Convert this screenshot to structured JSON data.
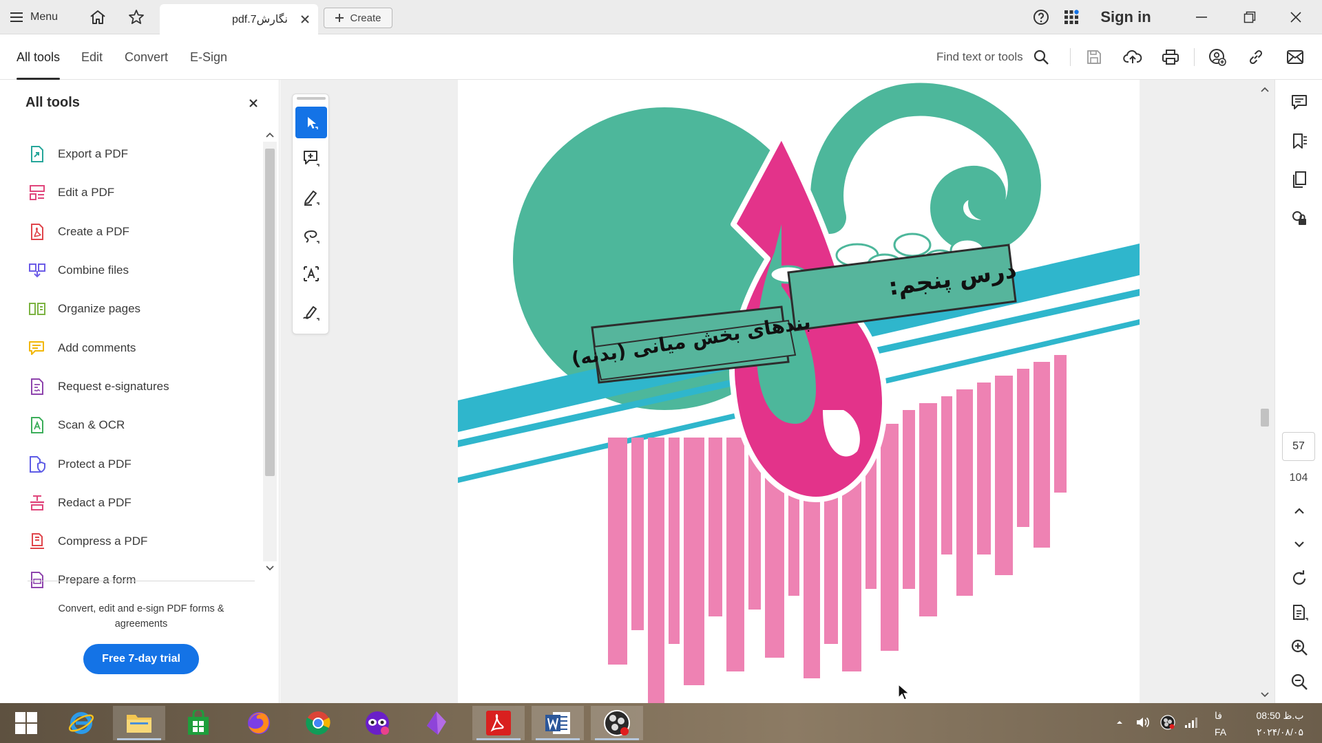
{
  "titlebar": {
    "menu_label": "Menu",
    "doc_tab_title": "نگارش7.pdf",
    "create_label": "Create",
    "sign_in_label": "Sign in"
  },
  "toolbar": {
    "tabs": [
      {
        "label": "All tools"
      },
      {
        "label": "Edit"
      },
      {
        "label": "Convert"
      },
      {
        "label": "E-Sign"
      }
    ],
    "find_placeholder": "Find text or tools"
  },
  "left_panel": {
    "title": "All tools",
    "items": [
      {
        "label": "Export a PDF",
        "icon": "export-pdf-icon",
        "color": "#26a69a"
      },
      {
        "label": "Edit a PDF",
        "icon": "edit-pdf-icon",
        "color": "#e0457b"
      },
      {
        "label": "Create a PDF",
        "icon": "create-pdf-icon",
        "color": "#e0454b"
      },
      {
        "label": "Combine files",
        "icon": "combine-files-icon",
        "color": "#6c5ce7"
      },
      {
        "label": "Organize pages",
        "icon": "organize-pages-icon",
        "color": "#7cb342"
      },
      {
        "label": "Add comments",
        "icon": "add-comments-icon",
        "color": "#f2b705"
      },
      {
        "label": "Request e-signatures",
        "icon": "request-esign-icon",
        "color": "#8e44ad"
      },
      {
        "label": "Scan & OCR",
        "icon": "scan-ocr-icon",
        "color": "#3cae5a"
      },
      {
        "label": "Protect a PDF",
        "icon": "protect-pdf-icon",
        "color": "#5e5ce6"
      },
      {
        "label": "Redact a PDF",
        "icon": "redact-pdf-icon",
        "color": "#e0457b"
      },
      {
        "label": "Compress a PDF",
        "icon": "compress-pdf-icon",
        "color": "#e0454b"
      },
      {
        "label": "Prepare a form",
        "icon": "prepare-form-icon",
        "color": "#8e44ad"
      }
    ],
    "promo_text": "Convert, edit and e-sign PDF forms & agreements",
    "trial_button": "Free 7-day trial"
  },
  "document": {
    "page_title_main": "درس پنجم:",
    "page_title_sub": "بندهای بخش میانی (بدنه)",
    "colors": {
      "teal": "#4db79b",
      "pink": "#e3338a",
      "light_pink": "#ee82b3",
      "cyan": "#2fb6cc",
      "banner": "#56b59c"
    }
  },
  "right_rail": {
    "current_page": "57",
    "total_pages": "104"
  },
  "taskbar": {
    "lang_top": "فا",
    "lang_bot": "FA",
    "time": "08:50 ب.ظ",
    "date": "۲۰۲۴/۰۸/۰۵"
  },
  "accent_color": "#1473e6"
}
